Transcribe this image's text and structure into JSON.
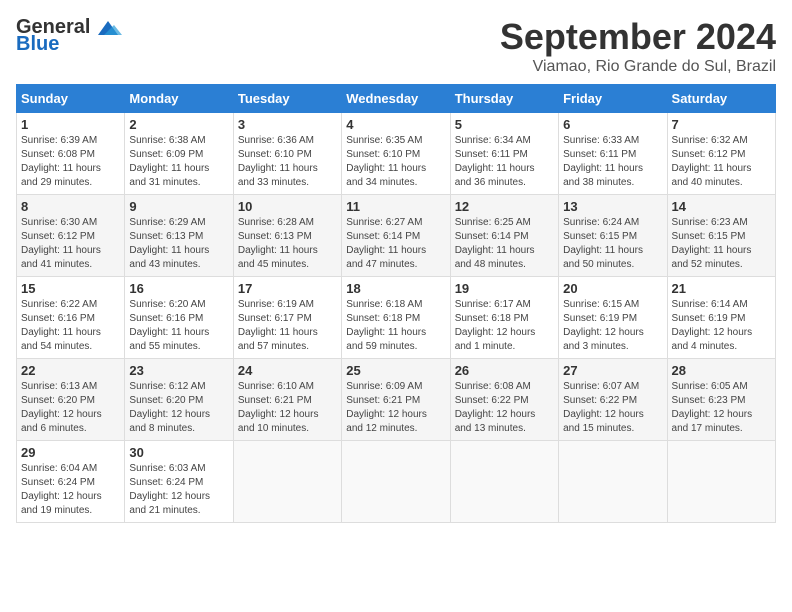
{
  "header": {
    "logo_general": "General",
    "logo_blue": "Blue",
    "month_title": "September 2024",
    "location": "Viamao, Rio Grande do Sul, Brazil"
  },
  "days_of_week": [
    "Sunday",
    "Monday",
    "Tuesday",
    "Wednesday",
    "Thursday",
    "Friday",
    "Saturday"
  ],
  "weeks": [
    [
      {
        "day": "1",
        "info": "Sunrise: 6:39 AM\nSunset: 6:08 PM\nDaylight: 11 hours\nand 29 minutes."
      },
      {
        "day": "2",
        "info": "Sunrise: 6:38 AM\nSunset: 6:09 PM\nDaylight: 11 hours\nand 31 minutes."
      },
      {
        "day": "3",
        "info": "Sunrise: 6:36 AM\nSunset: 6:10 PM\nDaylight: 11 hours\nand 33 minutes."
      },
      {
        "day": "4",
        "info": "Sunrise: 6:35 AM\nSunset: 6:10 PM\nDaylight: 11 hours\nand 34 minutes."
      },
      {
        "day": "5",
        "info": "Sunrise: 6:34 AM\nSunset: 6:11 PM\nDaylight: 11 hours\nand 36 minutes."
      },
      {
        "day": "6",
        "info": "Sunrise: 6:33 AM\nSunset: 6:11 PM\nDaylight: 11 hours\nand 38 minutes."
      },
      {
        "day": "7",
        "info": "Sunrise: 6:32 AM\nSunset: 6:12 PM\nDaylight: 11 hours\nand 40 minutes."
      }
    ],
    [
      {
        "day": "8",
        "info": "Sunrise: 6:30 AM\nSunset: 6:12 PM\nDaylight: 11 hours\nand 41 minutes."
      },
      {
        "day": "9",
        "info": "Sunrise: 6:29 AM\nSunset: 6:13 PM\nDaylight: 11 hours\nand 43 minutes."
      },
      {
        "day": "10",
        "info": "Sunrise: 6:28 AM\nSunset: 6:13 PM\nDaylight: 11 hours\nand 45 minutes."
      },
      {
        "day": "11",
        "info": "Sunrise: 6:27 AM\nSunset: 6:14 PM\nDaylight: 11 hours\nand 47 minutes."
      },
      {
        "day": "12",
        "info": "Sunrise: 6:25 AM\nSunset: 6:14 PM\nDaylight: 11 hours\nand 48 minutes."
      },
      {
        "day": "13",
        "info": "Sunrise: 6:24 AM\nSunset: 6:15 PM\nDaylight: 11 hours\nand 50 minutes."
      },
      {
        "day": "14",
        "info": "Sunrise: 6:23 AM\nSunset: 6:15 PM\nDaylight: 11 hours\nand 52 minutes."
      }
    ],
    [
      {
        "day": "15",
        "info": "Sunrise: 6:22 AM\nSunset: 6:16 PM\nDaylight: 11 hours\nand 54 minutes."
      },
      {
        "day": "16",
        "info": "Sunrise: 6:20 AM\nSunset: 6:16 PM\nDaylight: 11 hours\nand 55 minutes."
      },
      {
        "day": "17",
        "info": "Sunrise: 6:19 AM\nSunset: 6:17 PM\nDaylight: 11 hours\nand 57 minutes."
      },
      {
        "day": "18",
        "info": "Sunrise: 6:18 AM\nSunset: 6:18 PM\nDaylight: 11 hours\nand 59 minutes."
      },
      {
        "day": "19",
        "info": "Sunrise: 6:17 AM\nSunset: 6:18 PM\nDaylight: 12 hours\nand 1 minute."
      },
      {
        "day": "20",
        "info": "Sunrise: 6:15 AM\nSunset: 6:19 PM\nDaylight: 12 hours\nand 3 minutes."
      },
      {
        "day": "21",
        "info": "Sunrise: 6:14 AM\nSunset: 6:19 PM\nDaylight: 12 hours\nand 4 minutes."
      }
    ],
    [
      {
        "day": "22",
        "info": "Sunrise: 6:13 AM\nSunset: 6:20 PM\nDaylight: 12 hours\nand 6 minutes."
      },
      {
        "day": "23",
        "info": "Sunrise: 6:12 AM\nSunset: 6:20 PM\nDaylight: 12 hours\nand 8 minutes."
      },
      {
        "day": "24",
        "info": "Sunrise: 6:10 AM\nSunset: 6:21 PM\nDaylight: 12 hours\nand 10 minutes."
      },
      {
        "day": "25",
        "info": "Sunrise: 6:09 AM\nSunset: 6:21 PM\nDaylight: 12 hours\nand 12 minutes."
      },
      {
        "day": "26",
        "info": "Sunrise: 6:08 AM\nSunset: 6:22 PM\nDaylight: 12 hours\nand 13 minutes."
      },
      {
        "day": "27",
        "info": "Sunrise: 6:07 AM\nSunset: 6:22 PM\nDaylight: 12 hours\nand 15 minutes."
      },
      {
        "day": "28",
        "info": "Sunrise: 6:05 AM\nSunset: 6:23 PM\nDaylight: 12 hours\nand 17 minutes."
      }
    ],
    [
      {
        "day": "29",
        "info": "Sunrise: 6:04 AM\nSunset: 6:24 PM\nDaylight: 12 hours\nand 19 minutes."
      },
      {
        "day": "30",
        "info": "Sunrise: 6:03 AM\nSunset: 6:24 PM\nDaylight: 12 hours\nand 21 minutes."
      },
      null,
      null,
      null,
      null,
      null
    ]
  ]
}
